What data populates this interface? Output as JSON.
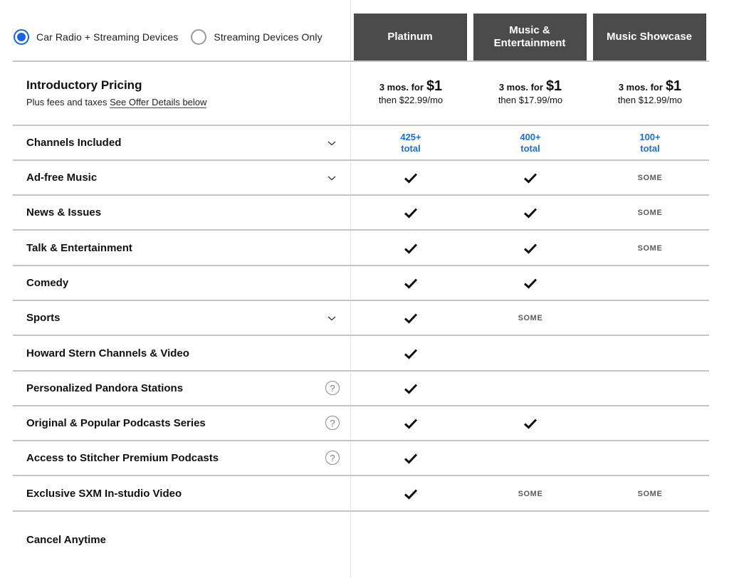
{
  "device_options": [
    {
      "label": "Car Radio + Streaming Devices",
      "selected": true
    },
    {
      "label": "Streaming Devices Only",
      "selected": false
    }
  ],
  "plans": [
    {
      "name": "Platinum",
      "intro_prefix": "3 mos. for",
      "intro_price": "$1",
      "then": "then $22.99/mo",
      "channels_count": "425+",
      "channels_unit": "total"
    },
    {
      "name": "Music & Entertainment",
      "intro_prefix": "3 mos. for",
      "intro_price": "$1",
      "then": "then $17.99/mo",
      "channels_count": "400+",
      "channels_unit": "total"
    },
    {
      "name": "Music Showcase",
      "intro_prefix": "3 mos. for",
      "intro_price": "$1",
      "then": "then $12.99/mo",
      "channels_count": "100+",
      "channels_unit": "total"
    }
  ],
  "intro": {
    "title": "Introductory Pricing",
    "fees_text": "Plus fees and taxes",
    "offer_link": "See Offer Details below"
  },
  "channels_row": {
    "label": "Channels Included",
    "icon": "chevron-down-icon"
  },
  "some_label": "SOME",
  "features": [
    {
      "label": "Ad-free Music",
      "icon": "chevron-down-icon",
      "values": [
        "check",
        "check",
        "some"
      ]
    },
    {
      "label": "News & Issues",
      "icon": null,
      "values": [
        "check",
        "check",
        "some"
      ]
    },
    {
      "label": "Talk & Entertainment",
      "icon": null,
      "values": [
        "check",
        "check",
        "some"
      ]
    },
    {
      "label": "Comedy",
      "icon": null,
      "values": [
        "check",
        "check",
        "none"
      ]
    },
    {
      "label": "Sports",
      "icon": "chevron-down-icon",
      "values": [
        "check",
        "some",
        "none"
      ]
    },
    {
      "label": "Howard Stern Channels & Video",
      "icon": null,
      "values": [
        "check",
        "none",
        "none"
      ]
    },
    {
      "label": "Personalized Pandora Stations",
      "icon": "help-icon",
      "values": [
        "check",
        "none",
        "none"
      ]
    },
    {
      "label": "Original & Popular Podcasts Series",
      "icon": "help-icon",
      "values": [
        "check",
        "check",
        "none"
      ]
    },
    {
      "label": "Access to Stitcher Premium Podcasts",
      "icon": "help-icon",
      "values": [
        "check",
        "none",
        "none"
      ]
    },
    {
      "label": "Exclusive SXM In-studio Video",
      "icon": null,
      "values": [
        "check",
        "some",
        "some"
      ]
    }
  ],
  "cancel_label": "Cancel Anytime",
  "help_glyph": "?",
  "colors": {
    "accent": "#1a63e6",
    "link_blue": "#1a6fd8",
    "header_bg": "#4b4b4b",
    "some_text": "#5a5a5a"
  }
}
